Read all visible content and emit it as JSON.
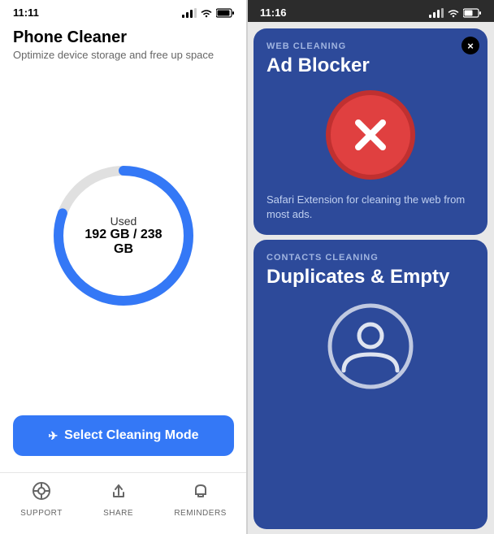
{
  "left": {
    "status_bar": {
      "time": "11:11",
      "signal_icon": "signal",
      "wifi_icon": "wifi",
      "battery_icon": "battery"
    },
    "header": {
      "title": "Phone Cleaner",
      "subtitle": "Optimize device storage and free up space"
    },
    "storage": {
      "label": "Used",
      "value": "192 GB / 238 GB",
      "used_gb": 192,
      "total_gb": 238
    },
    "button": {
      "label": "Select Cleaning Mode",
      "icon": "✈"
    },
    "nav": {
      "items": [
        {
          "label": "SUPPORT",
          "icon": "🛞"
        },
        {
          "label": "SHARE",
          "icon": "⬆"
        },
        {
          "label": "REMINDERS",
          "icon": "🔔"
        }
      ]
    }
  },
  "right": {
    "status_bar": {
      "time": "11:16"
    },
    "ad_blocker_card": {
      "category": "WEB CLEANING",
      "title": "Ad Blocker",
      "description": "Safari Extension for cleaning the web from most ads.",
      "close_label": "×"
    },
    "duplicates_card": {
      "category": "CONTACTS CLEANING",
      "title": "Duplicates & Empty"
    }
  }
}
